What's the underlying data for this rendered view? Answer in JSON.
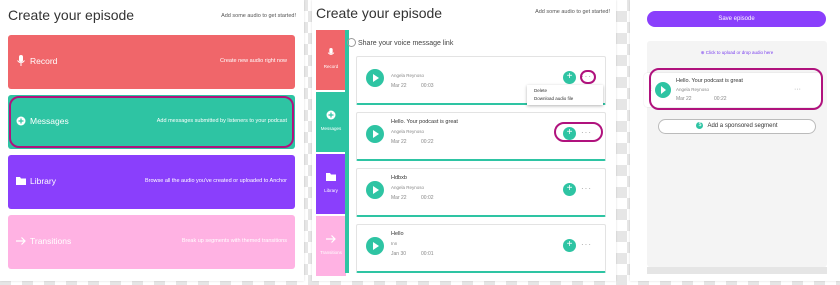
{
  "panel1": {
    "title": "Create your episode",
    "hint": "Add some audio to get started!",
    "cards": [
      {
        "label": "Record",
        "desc": "Create new audio right now",
        "color": "#f0666a",
        "icon": "microphone-icon"
      },
      {
        "label": "Messages",
        "desc": "Add messages submitted by listeners to your podcast",
        "color": "#2ec4a3",
        "icon": "message-plus-icon"
      },
      {
        "label": "Library",
        "desc": "Browse all the audio you've created or uploaded to Anchor",
        "color": "#8a3ffc",
        "icon": "folder-icon"
      },
      {
        "label": "Transitions",
        "desc": "Break up segments with themed transitions",
        "color": "#ffb2e3",
        "icon": "arrow-right-icon"
      }
    ]
  },
  "panel2": {
    "title": "Create your episode",
    "hint": "Add some audio to get started!",
    "sidebar": [
      {
        "label": "Record",
        "color": "#f0666a"
      },
      {
        "label": "Messages",
        "color": "#2ec4a3"
      },
      {
        "label": "Library",
        "color": "#8a3ffc"
      },
      {
        "label": "Transitions",
        "color": "#ffb2e3"
      }
    ],
    "share_label": "Share your voice message link",
    "episodes": [
      {
        "title": "",
        "author": "Angela Reynoso",
        "date": "Mar 22",
        "duration": "00:03"
      },
      {
        "title": "Hello. Your podcast is great",
        "author": "Angela Reynoso",
        "date": "Mar 22",
        "duration": "00:22"
      },
      {
        "title": "Hdbxb",
        "author": "Angela Reynoso",
        "date": "Mar 22",
        "duration": "00:02"
      },
      {
        "title": "Hello",
        "author": "Inn",
        "date": "Jan 30",
        "duration": "00:01"
      }
    ],
    "menu": {
      "delete": "Delete",
      "download": "Download audio file"
    }
  },
  "panel3": {
    "save_label": "Save episode",
    "upload_label": "Click to upload or drop audio here",
    "episode": {
      "title": "Hello. Your podcast is great",
      "author": "Angela Reynoso",
      "date": "Mar 22",
      "duration": "00:22"
    },
    "sponsor_label": "Add a sponsored segment"
  }
}
